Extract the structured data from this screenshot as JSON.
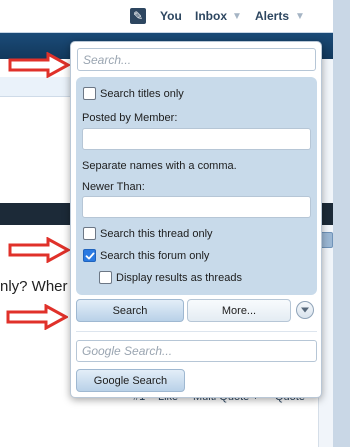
{
  "topnav": {
    "you": "You",
    "inbox": "Inbox",
    "alerts": "Alerts",
    "caret": "▼"
  },
  "background": {
    "post_text": "nly? Wher",
    "footer": {
      "post_number": "#1",
      "like": "Like",
      "multi_quote": "Multi Quote +",
      "quote": "Quote"
    }
  },
  "search_popup": {
    "search_placeholder": "Search...",
    "search_value": "",
    "options": {
      "titles_only": {
        "label": "Search titles only",
        "checked": false
      },
      "posted_by_label": "Posted by Member:",
      "posted_by_value": "",
      "posted_by_hint": "Separate names with a comma.",
      "newer_than_label": "Newer Than:",
      "newer_than_value": "",
      "this_thread": {
        "label": "Search this thread only",
        "checked": false
      },
      "this_forum": {
        "label": "Search this forum only",
        "checked": true
      },
      "as_threads": {
        "label": "Display results as threads",
        "checked": false
      }
    },
    "search_button": "Search",
    "more_button": "More...",
    "google_placeholder": "Google Search...",
    "google_button": "Google Search"
  },
  "colors": {
    "arrow_red": "#e0312a",
    "options_panel": "#c8daea",
    "navbar": "#1b4b78",
    "checkbox_checked": "#2a7ae2"
  },
  "icons": {
    "arrow": "red-outline-right-arrow",
    "pencil": "pencil-edit-icon",
    "more_toggle": "chevron-down-circle-icon"
  }
}
